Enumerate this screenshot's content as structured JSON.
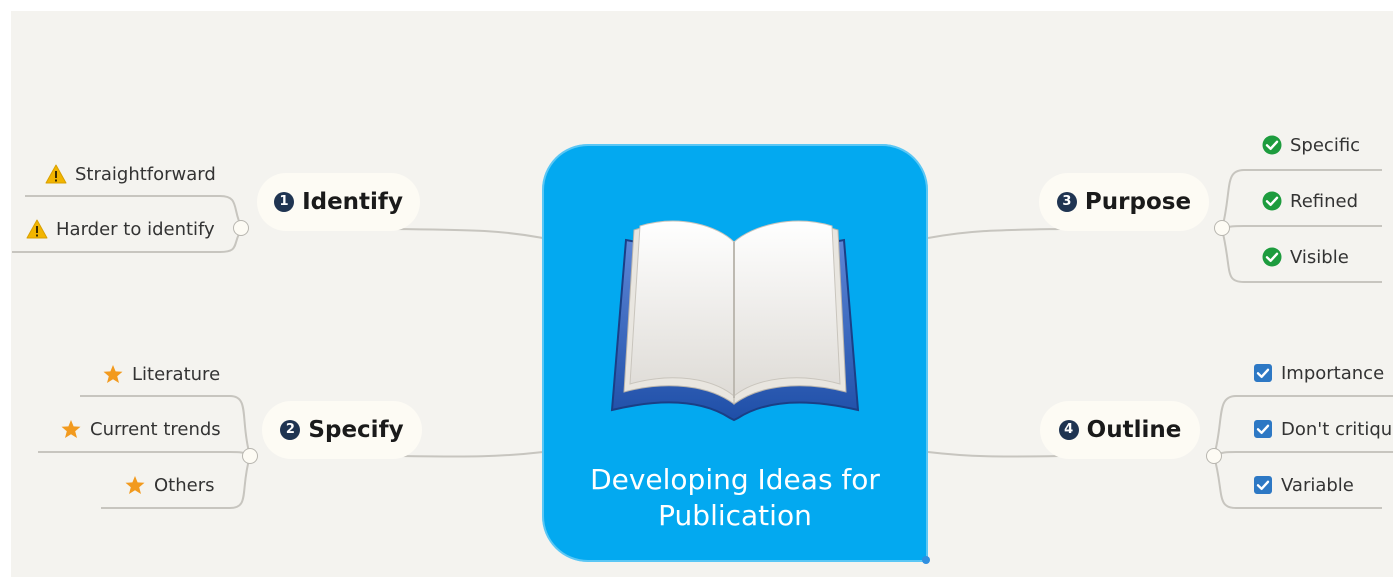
{
  "central": {
    "title_line1": "Developing Ideas for",
    "title_line2": "Publication",
    "color": "#03a9f0",
    "icon": "open-book-icon"
  },
  "topics": [
    {
      "num": "1",
      "label": "Identify",
      "subtopics": [
        {
          "label": "Straightforward",
          "icon": "warning-icon"
        },
        {
          "label": "Harder to identify",
          "icon": "warning-icon"
        }
      ]
    },
    {
      "num": "2",
      "label": "Specify",
      "subtopics": [
        {
          "label": "Literature",
          "icon": "star-icon"
        },
        {
          "label": "Current trends",
          "icon": "star-icon"
        },
        {
          "label": "Others",
          "icon": "star-icon"
        }
      ]
    },
    {
      "num": "3",
      "label": "Purpose",
      "subtopics": [
        {
          "label": "Specific",
          "icon": "check-circle-icon"
        },
        {
          "label": "Refined",
          "icon": "check-circle-icon"
        },
        {
          "label": "Visible",
          "icon": "check-circle-icon"
        }
      ]
    },
    {
      "num": "4",
      "label": "Outline",
      "subtopics": [
        {
          "label": "Importance",
          "icon": "checkbox-icon"
        },
        {
          "label": "Don't critique",
          "icon": "checkbox-icon"
        },
        {
          "label": "Variable",
          "icon": "checkbox-icon"
        }
      ]
    }
  ],
  "colors": {
    "background": "#f4f3ef",
    "topic_number": "#1f3451",
    "warning": "#f2b500",
    "star": "#f29a1e",
    "check": "#1d9c3e",
    "checkbox": "#2d78c4"
  }
}
